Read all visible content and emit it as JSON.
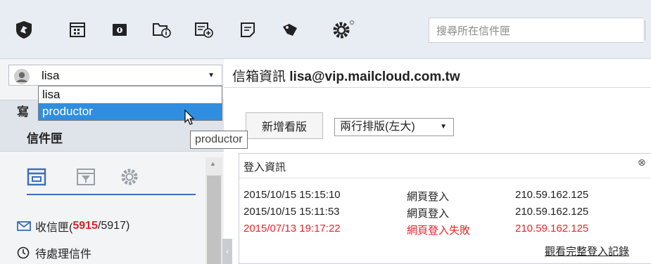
{
  "toolbar": {
    "icons": [
      "logo-icon",
      "calendar-icon",
      "archive-icon",
      "folder-info-icon",
      "compose-icon",
      "note-icon",
      "tag-icon",
      "gear-icon"
    ],
    "search_placeholder": "搜尋所在信件匣"
  },
  "account": {
    "selected": "lisa",
    "options": [
      "lisa",
      "productor"
    ],
    "highlighted": "productor",
    "tooltip": "productor"
  },
  "sidebar": {
    "header_clip": "寫",
    "mailbox_label": "信件匣",
    "folders": [
      {
        "name": "收信匣(",
        "unread": "5915",
        "total": "/5917)"
      },
      {
        "name": "待處理信件"
      }
    ]
  },
  "main": {
    "title_lead": "信箱資訊 ",
    "title_addr": "lisa@vip.mailcloud.com.tw",
    "new_view_button": "新增看版",
    "layout_select": "兩行排版(左大)",
    "login_panel": {
      "title": "登入資訊",
      "close": "⊗",
      "rows": [
        {
          "time": "2015/10/15 15:15:10",
          "type": "網頁登入",
          "ip": "210.59.162.125",
          "failed": false
        },
        {
          "time": "2015/10/15 15:11:53",
          "type": "網頁登入",
          "ip": "210.59.162.125",
          "failed": false
        },
        {
          "time": "2015/07/13 19:17:22",
          "type": "網頁登入失敗",
          "ip": "210.59.162.125",
          "failed": true
        }
      ],
      "more_link": "觀看完整登入記錄"
    }
  },
  "colors": {
    "accent": "#2f8ee0",
    "fail": "#e6262b",
    "unread": "#d8232a"
  }
}
